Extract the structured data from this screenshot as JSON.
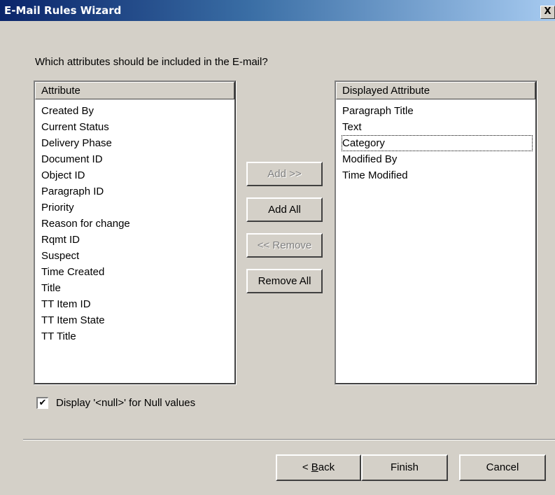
{
  "window": {
    "title": "E-Mail Rules Wizard",
    "close_label": "X"
  },
  "prompt": "Which attributes should be included in the E-mail?",
  "available": {
    "header": "Attribute",
    "items": [
      "Created By",
      "Current Status",
      "Delivery Phase",
      "Document ID",
      "Object ID",
      "Paragraph ID",
      "Priority",
      "Reason for change",
      "Rqmt ID",
      "Suspect",
      "Time Created",
      "Title",
      "TT Item ID",
      "TT Item State",
      "TT Title"
    ]
  },
  "displayed": {
    "header": "Displayed Attribute",
    "items": [
      "Paragraph Title",
      "Text",
      "Category",
      "Modified By",
      "Time Modified"
    ],
    "focused_index": 2
  },
  "actions": {
    "add": "Add >>",
    "add_all": "Add All",
    "remove": "<< Remove",
    "remove_all": "Remove All"
  },
  "null_option": {
    "label": "Display '<null>' for Null values",
    "checked": true,
    "check_glyph": "✔"
  },
  "footer": {
    "back_prefix": "< ",
    "back_accel": "B",
    "back_rest": "ack",
    "finish": "Finish",
    "cancel": "Cancel"
  }
}
